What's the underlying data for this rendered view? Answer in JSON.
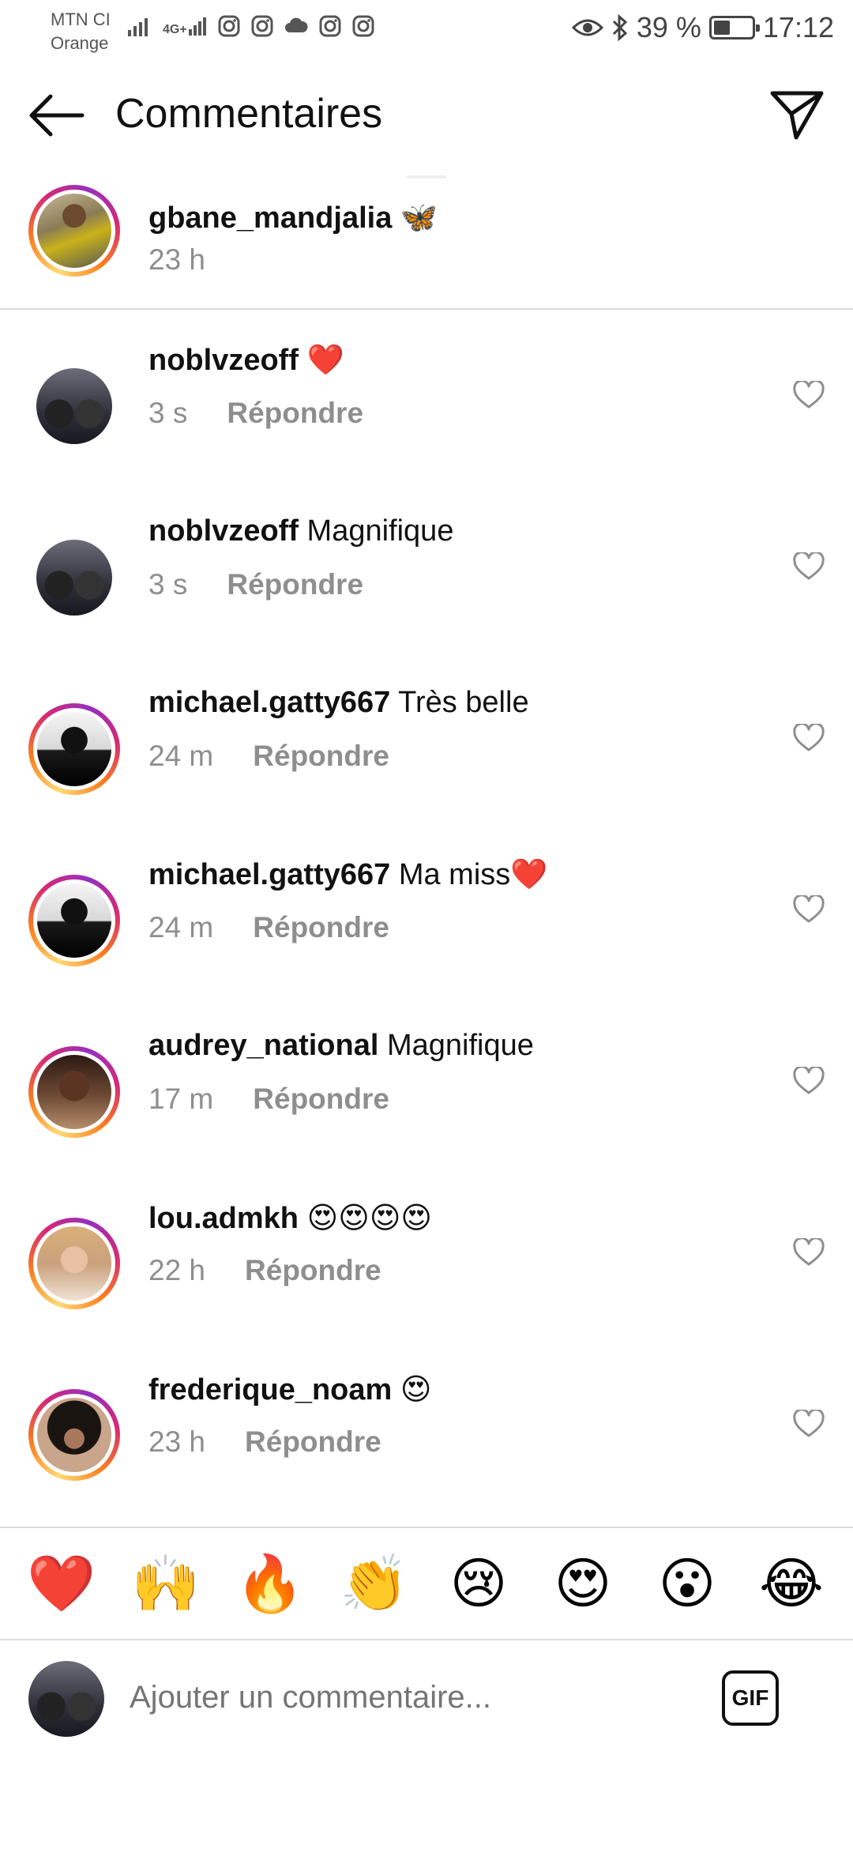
{
  "status_bar": {
    "carrier_line1": "MTN CI",
    "carrier_line2": "Orange",
    "network": "4G+",
    "battery": "39 %",
    "battery_level": 0.39,
    "time": "17:12"
  },
  "header": {
    "title": "Commentaires",
    "back_icon": "arrow-left-icon",
    "send_icon": "paper-plane-icon"
  },
  "caption": {
    "username": "gbane_mandjalia",
    "text": "🦋",
    "time": "23 h"
  },
  "reply_label": "Répondre",
  "comments": [
    {
      "username": "noblvzeoff",
      "text": "❤️",
      "time": "3 s",
      "avatar_ring": false
    },
    {
      "username": "noblvzeoff",
      "text": "Magnifique",
      "time": "3 s",
      "avatar_ring": false
    },
    {
      "username": "michael.gatty667",
      "text": "Très belle",
      "time": "24 m",
      "avatar_ring": true
    },
    {
      "username": "michael.gatty667",
      "text": "Ma miss❤️",
      "time": "24 m",
      "avatar_ring": true
    },
    {
      "username": "audrey_national",
      "text": "Magnifique",
      "time": "17 m",
      "avatar_ring": true
    },
    {
      "username": "lou.admkh",
      "text": "😍😍😍😍",
      "time": "22 h",
      "avatar_ring": true
    },
    {
      "username": "frederique_noam",
      "text": "😍",
      "time": "23 h",
      "avatar_ring": true
    }
  ],
  "emoji_bar": [
    "❤️",
    "🙌",
    "🔥",
    "👏",
    "😢",
    "😍",
    "😮",
    "😂"
  ],
  "composer": {
    "placeholder": "Ajouter un commentaire...",
    "gif_label": "GIF"
  },
  "colors": {
    "text": "#111111",
    "secondary": "#8e8e8e",
    "divider": "#dbdbdb",
    "placeholder": "#bdbdbd"
  }
}
